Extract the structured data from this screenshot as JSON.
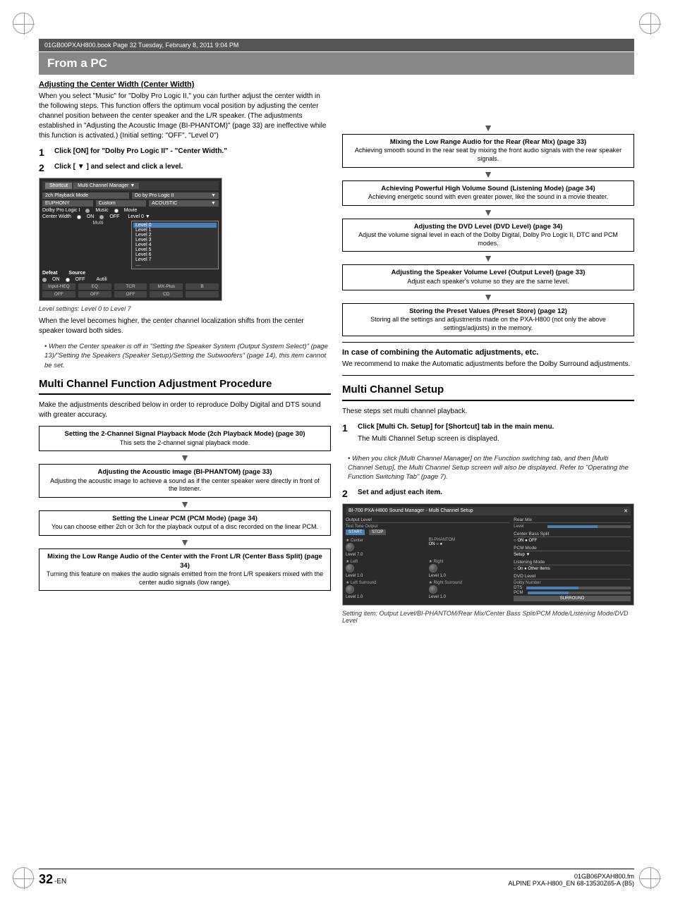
{
  "page": {
    "corners": [
      "tl",
      "tr",
      "bl",
      "br"
    ],
    "filename": "01GB00PXAH800.book  Page 32  Tuesday, February 8, 2011  9:04 PM",
    "footer_filename": "01GB06PXAH800.fm",
    "footer_page": "32",
    "footer_sub": "-EN",
    "footer_right": "ALPINE PXA-H800_EN 68-13530Z65-A (B5)"
  },
  "header": {
    "title": "From a PC"
  },
  "left": {
    "adjusting_center_width": {
      "title": "Adjusting the Center Width (Center Width)",
      "body": "When you select \"Music\" for \"Dolby Pro Logic II,\" you can further adjust the center width in the following steps. This function offers the optimum vocal position by adjusting the center channel position between the center speaker and the L/R speaker. (The adjustments established in \"Adjusting the Acoustic Image (BI-PHANTOM)\" (page 33) are ineffective while this function is activated.) (Initial setting: \"OFF\", \"Level 0\")"
    },
    "step1": {
      "num": "1",
      "text": "Click [ON] for \"Dolby Pro Logic II\" - \"Center Width.\""
    },
    "step2": {
      "num": "2",
      "text": "Click [ ▼ ] and select and click a level."
    },
    "screenshot_caption": "Level settings: Level 0 to Level 7",
    "when_higher": "When the level becomes higher, the center channel localization shifts from the center speaker toward both sides.",
    "note_italic": "When the Center speaker is off in \"Setting the Speaker System (Output System Select)\" (page 13)/\"Setting the Speakers (Speaker Setup)/Setting the Subwoofers\" (page 14), this item cannot be set.",
    "multi_channel_title": "Multi Channel Function Adjustment Procedure",
    "multi_channel_body": "Make the adjustments described below in order to reproduce Dolby Digital and DTS sound with greater accuracy.",
    "flow_boxes": [
      {
        "title": "Setting the 2-Channel Signal Playback Mode (2ch Playback Mode) (page 30)",
        "body": "This sets the 2-channel signal playback mode."
      },
      {
        "title": "Adjusting the Acoustic Image (BI-PHANTOM) (page 33)",
        "body": "Adjusting the acoustic image to achieve a sound as if the center speaker were directly in front of the listener."
      },
      {
        "title": "Setting the Linear PCM (PCM Mode) (page 34)",
        "body": "You can choose either 2ch or 3ch for the playback output of a disc recorded on the linear PCM."
      },
      {
        "title": "Mixing the Low Range Audio of the Center with the Front L/R (Center Bass Split) (page 34)",
        "body": "Turning this feature on makes the audio signals emitted from the front L/R speakers mixed with the center audio signals (low range)."
      }
    ]
  },
  "right": {
    "flow_boxes": [
      {
        "title": "Mixing the Low Range Audio for the Rear (Rear Mix) (page 33)",
        "body": "Achieving smooth sound in the rear seat by mixing the front audio signals with the rear speaker signals."
      },
      {
        "title": "Achieving Powerful High Volume Sound (Listening Mode) (page 34)",
        "body": "Achieving energetic sound with even greater power, like the sound in a movie theater."
      },
      {
        "title": "Adjusting the DVD Level (DVD Level) (page 34)",
        "body": "Adjust the volume signal level in each of the Dolby Digital, Dolby Pro Logic II, DTC and PCM modes."
      },
      {
        "title": "Adjusting the Speaker Volume Level (Output Level) (page 33)",
        "body": "Adjust each speaker's volume so they are the same level."
      },
      {
        "title": "Storing the Preset Values (Preset Store) (page 12)",
        "body": "Storing all the settings and adjustments made on the PXA-H800 (not only the above settings/adjusts) in the memory."
      }
    ],
    "combining_title": "In case of combining the Automatic adjustments, etc.",
    "combining_body": "We recommend to make the Automatic adjustments before the Dolby Surround adjustments.",
    "multi_channel_setup_title": "Multi Channel Setup",
    "multi_channel_setup_body": "These steps set multi channel playback.",
    "step1": {
      "num": "1",
      "label": "Click [Multi Ch. Setup] for [Shortcut] tab in the main menu.",
      "note": "The Multi Channel Setup screen is displayed."
    },
    "step1_bullet": "When you click [Multi Channel Manager] on the Function switching tab, and then [Multi Channel Setup], the Multi Channel Setup screen will also be displayed. Refer to \"Operating the Function Switching Tab\" (page 7).",
    "step2": {
      "num": "2",
      "label": "Set and adjust each item."
    },
    "screenshot_caption": "Setting item: Output Level/BI-PHANTOM/Rear Mix/Center Bass Split/PCM Mode/Listening Mode/DVD Level"
  },
  "screenshot": {
    "tab1": "Shortcut",
    "tab2": "Multi Channel Manager",
    "row1_label": "2ch Playback Mode",
    "row1_value": "Do by Pro Logic II",
    "row2a": "EUPHONY",
    "row2b": "Custom",
    "row2c": "ACOUSTIC",
    "row3": "Dolby Pro Logic I",
    "row3_options": [
      "Music",
      "Movie"
    ],
    "row4": "Center Width",
    "row4_options": [
      "ON",
      "OFF"
    ],
    "row4_level": "Level 0",
    "row5": "MuIti",
    "defeat": "Defeat",
    "source": "Source",
    "defeat_options": [
      "ON",
      "OFF"
    ],
    "source_value": "Autili",
    "bottom_row": [
      "Input-HEQ",
      "EQ",
      "TCR",
      "MX-Plus",
      "B"
    ],
    "bottom_row2": [
      "OFF",
      "OFF",
      "OFF",
      "CD"
    ],
    "dropdown_items": [
      "Level 0",
      "Level 1",
      "Level 2",
      "Level 3",
      "Level 4",
      "Level 5",
      "Level 6",
      "Level 7",
      "...."
    ]
  }
}
